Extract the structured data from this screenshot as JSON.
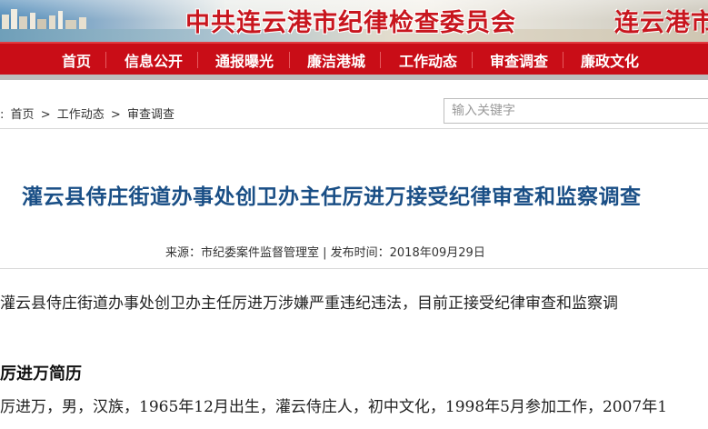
{
  "banner": {
    "title": "中共连云港市纪律检查委员会",
    "title_right": "连云港市"
  },
  "nav": {
    "items": [
      "首页",
      "信息公开",
      "通报曝光",
      "廉洁港城",
      "工作动态",
      "审查调查",
      "廉政文化"
    ]
  },
  "breadcrumb": {
    "home": "首页",
    "sep1": ">",
    "section": "工作动态",
    "sep2": ">",
    "current": "审查调查"
  },
  "search": {
    "placeholder": "输入关键字"
  },
  "article": {
    "title": "灌云县侍庄街道办事处创卫办主任厉进万接受纪律审查和监察调查",
    "meta": "来源：市纪委案件监督管理室 | 发布时间：2018年09月29日",
    "paragraph1": "灌云县侍庄街道办事处创卫办主任厉进万涉嫌严重违纪违法，目前正接受纪律审查和监察调",
    "section_title": "厉进万简历",
    "paragraph2": "厉进万，男，汉族，1965年12月出生，灌云侍庄人，初中文化，1998年5月参加工作，2007年1"
  },
  "colors": {
    "nav_red": "#c90d17",
    "title_red": "#c8161e",
    "headline_blue": "#1a4f86"
  }
}
